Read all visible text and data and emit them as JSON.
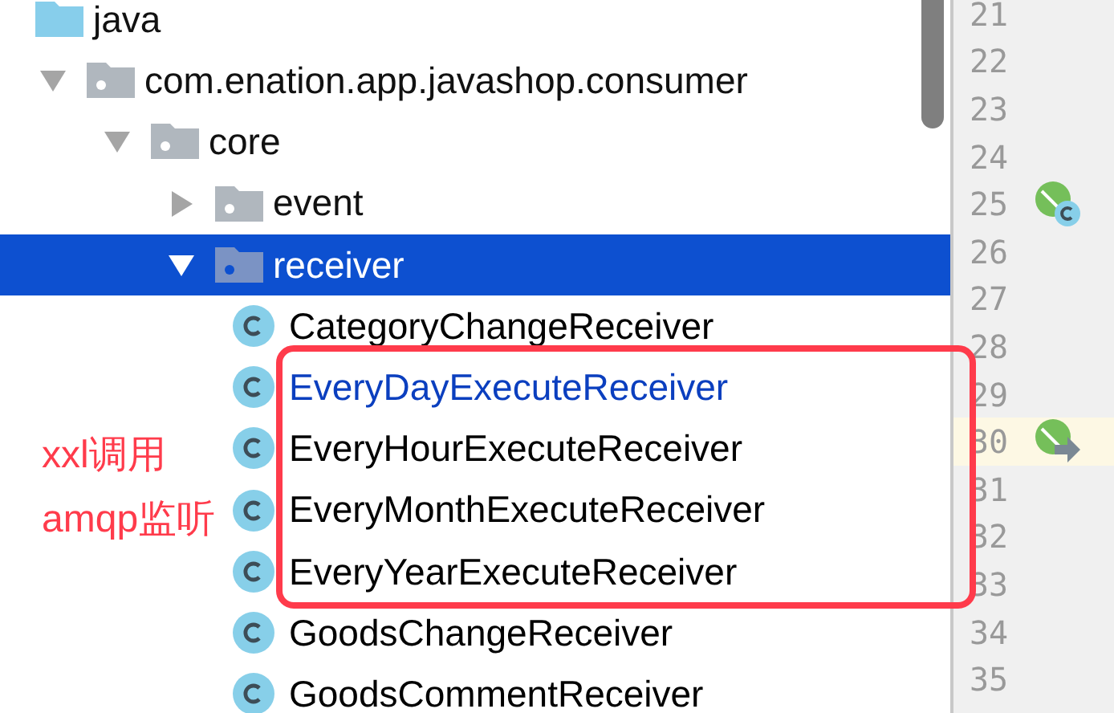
{
  "tree": [
    {
      "name": "java",
      "kind": "source_folder",
      "selected": false,
      "children": [
        {
          "name": "com.enation.app.javashop.consumer",
          "kind": "package",
          "expanded": true,
          "selected": false,
          "children": [
            {
              "name": "core",
              "kind": "package",
              "expanded": true,
              "selected": false,
              "children": [
                {
                  "name": "event",
                  "kind": "package",
                  "expanded": false,
                  "selected": false
                },
                {
                  "name": "receiver",
                  "kind": "package",
                  "expanded": true,
                  "selected": true,
                  "children": [
                    {
                      "name": "CategoryChangeReceiver",
                      "kind": "class",
                      "selected": false,
                      "color": "#000000"
                    },
                    {
                      "name": "EveryDayExecuteReceiver",
                      "kind": "class",
                      "selected": false,
                      "color": "#0b3fbf"
                    },
                    {
                      "name": "EveryHourExecuteReceiver",
                      "kind": "class",
                      "selected": false,
                      "color": "#000000"
                    },
                    {
                      "name": "EveryMonthExecuteReceiver",
                      "kind": "class",
                      "selected": false,
                      "color": "#000000"
                    },
                    {
                      "name": "EveryYearExecuteReceiver",
                      "kind": "class",
                      "selected": false,
                      "color": "#000000"
                    },
                    {
                      "name": "GoodsChangeReceiver",
                      "kind": "class",
                      "selected": false,
                      "color": "#000000"
                    },
                    {
                      "name": "GoodsCommentReceiver",
                      "kind": "class",
                      "selected": false,
                      "color": "#000000"
                    }
                  ]
                }
              ]
            }
          ]
        }
      ]
    }
  ],
  "annotation": {
    "lines": [
      "xxl调用",
      "amqp监听"
    ]
  },
  "gutter": [
    {
      "number": "21",
      "highlighted": false,
      "kind": "plain"
    },
    {
      "number": "22",
      "highlighted": false,
      "kind": "plain"
    },
    {
      "number": "23",
      "highlighted": false,
      "kind": "plain"
    },
    {
      "number": "24",
      "highlighted": false,
      "kind": "plain"
    },
    {
      "number": "25",
      "highlighted": false,
      "kind": "implemented"
    },
    {
      "number": "26",
      "highlighted": false,
      "kind": "plain"
    },
    {
      "number": "27",
      "highlighted": false,
      "kind": "plain"
    },
    {
      "number": "28",
      "highlighted": false,
      "kind": "plain"
    },
    {
      "number": "29",
      "highlighted": false,
      "kind": "plain"
    },
    {
      "number": "30",
      "highlighted": true,
      "kind": "overrides"
    },
    {
      "number": "31",
      "highlighted": false,
      "kind": "plain"
    },
    {
      "number": "32",
      "highlighted": false,
      "kind": "plain"
    },
    {
      "number": "33",
      "highlighted": false,
      "kind": "plain"
    },
    {
      "number": "34",
      "highlighted": false,
      "kind": "plain"
    },
    {
      "number": "35",
      "highlighted": false,
      "kind": "plain"
    }
  ]
}
